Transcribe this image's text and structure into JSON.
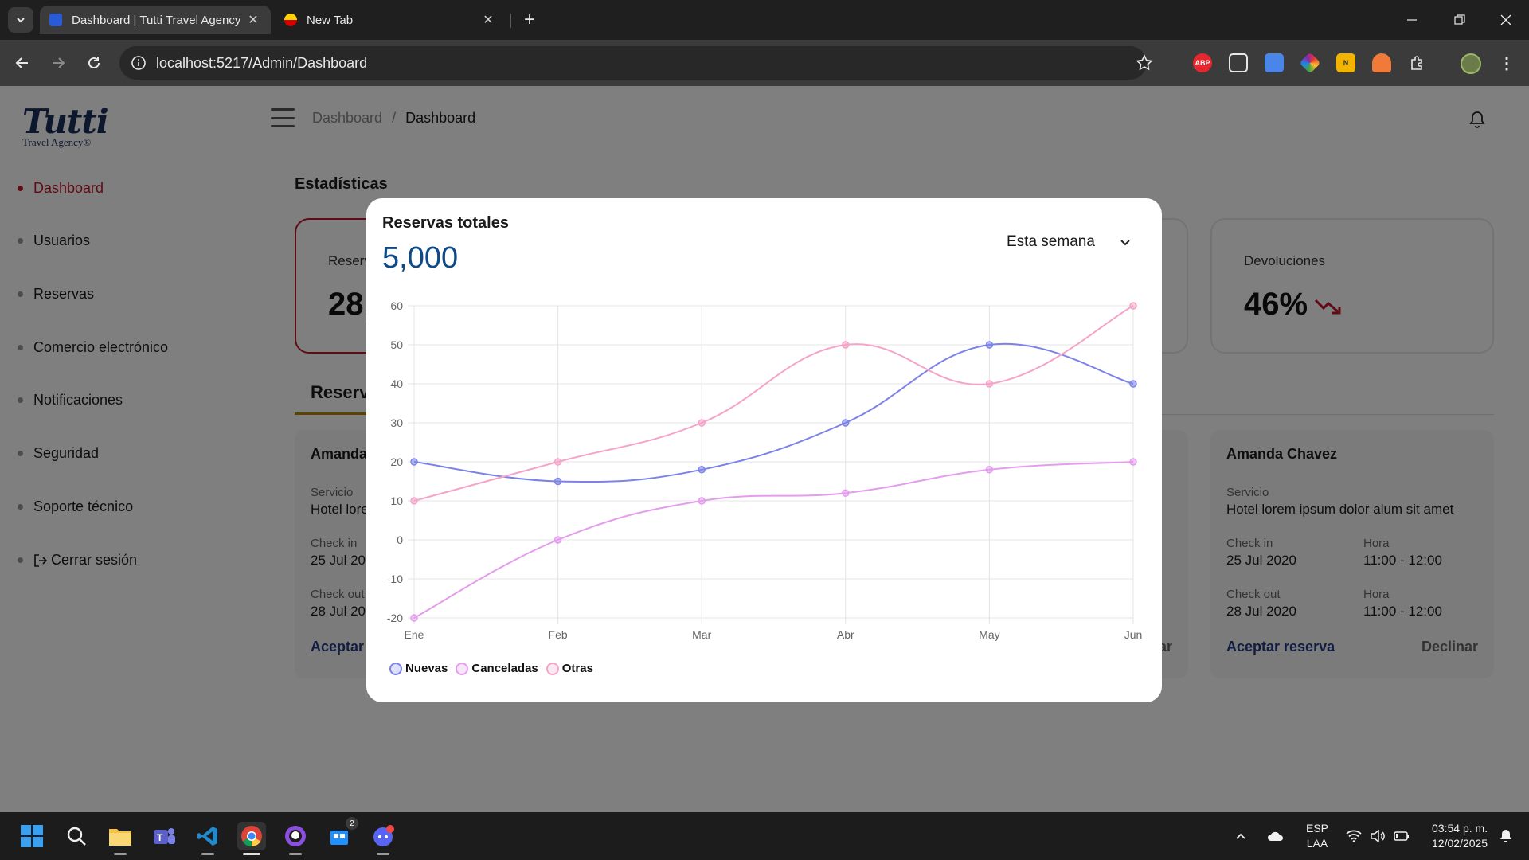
{
  "browser": {
    "tabs": [
      {
        "title": "Dashboard | Tutti Travel Agency",
        "active": true
      },
      {
        "title": "New Tab",
        "active": false
      }
    ],
    "url": "localhost:5217/Admin/Dashboard",
    "extensions": [
      "adblock-icon",
      "screen-icon",
      "doc-icon",
      "color-icon",
      "folder-icon",
      "fox-icon",
      "puzzle-icon",
      "profile-avatar"
    ]
  },
  "app": {
    "logo": {
      "brand": "Tutti",
      "sub": "Travel Agency®"
    },
    "sidebar": {
      "items": [
        {
          "label": "Dashboard",
          "active": true
        },
        {
          "label": "Usuarios"
        },
        {
          "label": "Reservas"
        },
        {
          "label": "Comercio electrónico"
        },
        {
          "label": "Notificaciones"
        },
        {
          "label": "Seguridad"
        },
        {
          "label": "Soporte técnico"
        },
        {
          "label": "Cerrar sesión",
          "icon": "logout-icon"
        }
      ]
    },
    "breadcrumb": {
      "parent": "Dashboard",
      "separator": "/",
      "current": "Dashboard"
    },
    "stats": {
      "section_title": "Estadísticas",
      "card1": {
        "label": "Reservas totales",
        "value": "28,500"
      },
      "card3": {
        "label": "Devoluciones",
        "value": "46%",
        "trend": "down"
      }
    },
    "reservations": {
      "title": "Reservas",
      "cards": [
        {
          "name": "Amanda Chavez",
          "service_label": "Servicio",
          "service": "Hotel lorem ipsum dolor alum sit amet",
          "checkin_label": "Check in",
          "checkin": "25 Jul 2020",
          "checkout_label": "Check out",
          "checkout": "28 Jul 2020",
          "hora_label": "Hora",
          "hora": "11:00 - 12:00",
          "accept": "Aceptar reserva",
          "decline": "Declinar"
        }
      ]
    }
  },
  "modal": {
    "title": "Reservas totales",
    "total": "5,000",
    "period": "Esta semana"
  },
  "chart_data": {
    "type": "line",
    "categories": [
      "Ene",
      "Feb",
      "Mar",
      "Abr",
      "May",
      "Jun"
    ],
    "ylim": [
      -20,
      60
    ],
    "yticks": [
      60,
      50,
      40,
      30,
      20,
      10,
      0,
      -10,
      -20
    ],
    "grid": true,
    "legend": "bottom-left",
    "series": [
      {
        "name": "Nuevas",
        "values": [
          20,
          15,
          18,
          30,
          50,
          40
        ],
        "color": "#7b83e8"
      },
      {
        "name": "Canceladas",
        "values": [
          -20,
          0,
          10,
          12,
          18,
          20
        ],
        "color": "#e49ced"
      },
      {
        "name": "Otras",
        "values": [
          10,
          20,
          30,
          50,
          40,
          60
        ],
        "color": "#f5a3c8"
      }
    ]
  },
  "taskbar": {
    "apps": [
      "windows-start-icon",
      "search-icon",
      "file-explorer-icon",
      "teams-icon",
      "vscode-icon",
      "chrome-icon",
      "github-icon",
      "store-icon",
      "discord-icon"
    ],
    "store_badge": "2",
    "language": {
      "line1": "ESP",
      "line2": "LAA"
    },
    "time": "03:54 p. m.",
    "date": "12/02/2025"
  }
}
